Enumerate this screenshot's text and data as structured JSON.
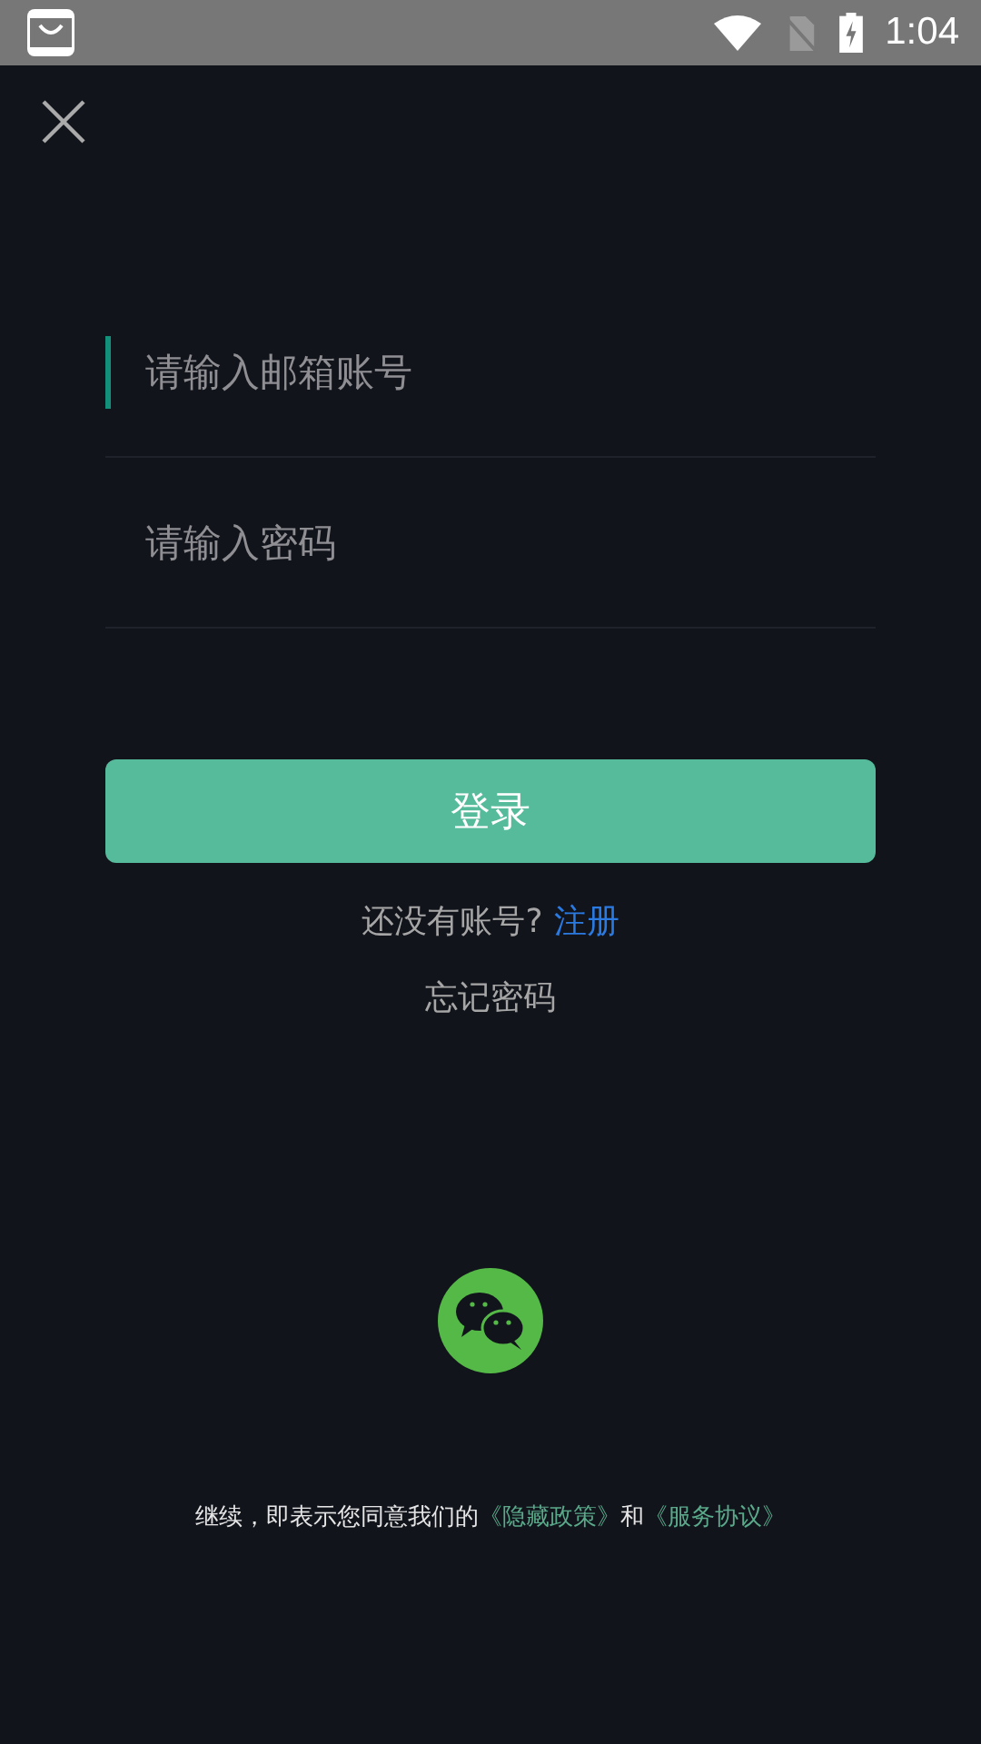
{
  "status_bar": {
    "time": "1:04"
  },
  "fields": [
    {
      "placeholder": "请输入邮箱账号",
      "focused": true
    },
    {
      "placeholder": "请输入密码",
      "focused": false
    }
  ],
  "login_button": "登录",
  "register_prompt": {
    "text": "还没有账号?",
    "link": "注册"
  },
  "forgot_password": "忘记密码",
  "agreement": [
    {
      "kind": "text",
      "text": "继续，即表示您同意我们的"
    },
    {
      "kind": "link",
      "text": "《隐藏政策》"
    },
    {
      "kind": "text",
      "text": "和"
    },
    {
      "kind": "link",
      "text": "《服务协议》"
    }
  ]
}
